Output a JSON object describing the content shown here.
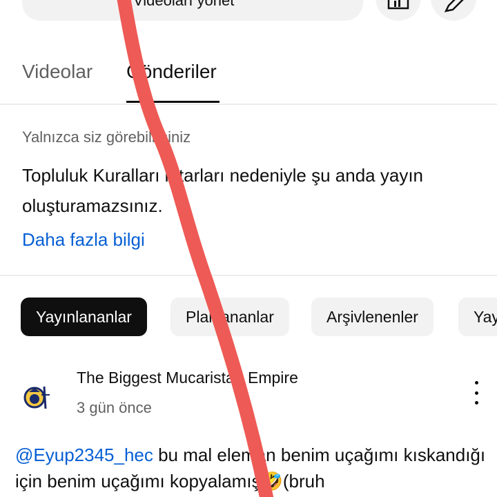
{
  "header": {
    "manage_videos_label": "Videoları yönet",
    "stats_icon": "bar-chart-icon",
    "edit_icon": "pencil-icon"
  },
  "tabs": [
    {
      "label": "Videolar",
      "active": false
    },
    {
      "label": "Gönderiler",
      "active": true
    }
  ],
  "notice": {
    "visibility": "Yalnızca siz görebilirsiniz",
    "message": "Topluluk Kuralları ihtarları nedeniyle şu anda yayın oluşturamazsınız.",
    "link": "Daha fazla bilgi"
  },
  "filters": [
    {
      "label": "Yayınlananlar",
      "active": true
    },
    {
      "label": "Planlananlar",
      "active": false
    },
    {
      "label": "Arşivlenenler",
      "active": false
    },
    {
      "label": "Yay",
      "active": false
    }
  ],
  "post": {
    "channel": "The Biggest Mucaristan Empire",
    "time": "3 gün önce",
    "mention": "@Eyup2345_hec",
    "text": " bu mal eleman benim uçağımı kıskandığı için benim uçağımı kopyalamış🤣(bruh"
  },
  "colors": {
    "accent_link": "#065fd4",
    "chip_active": "#0f0f0f",
    "overlay_stroke": "#ee5a55"
  }
}
